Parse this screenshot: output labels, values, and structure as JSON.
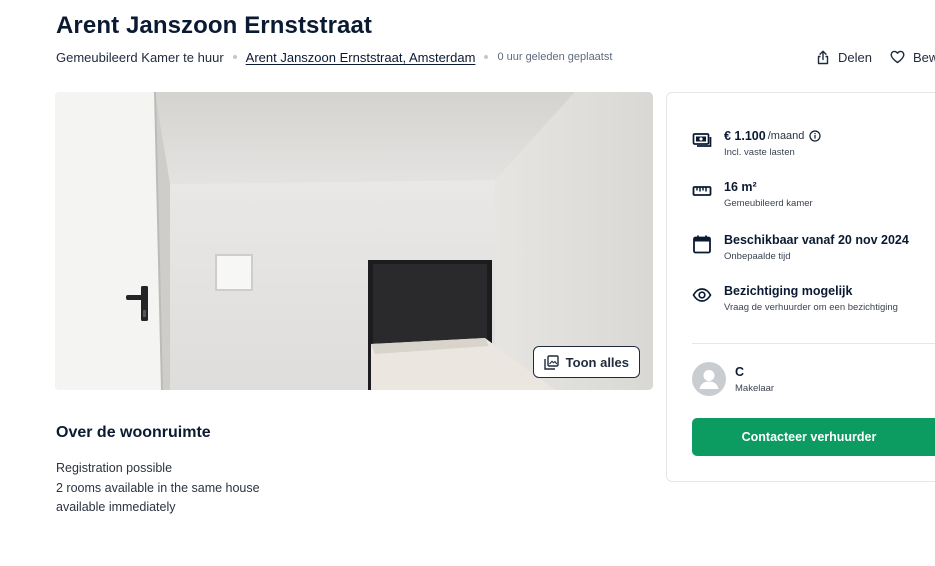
{
  "listing": {
    "title": "Arent Janszoon Ernststraat",
    "type": "Gemeubileerd Kamer te huur",
    "address_link": "Arent Janszoon Ernststraat, Amsterdam",
    "posted": "0 uur geleden geplaatst"
  },
  "actions": {
    "share": "Delen",
    "save": "Bew"
  },
  "gallery": {
    "show_all": "Toon alles"
  },
  "about": {
    "title": "Over de woonruimte",
    "lines": [
      "Registration possible",
      "2 rooms available in the same house",
      "available immediately"
    ]
  },
  "details": {
    "price": {
      "value": "€ 1.100",
      "unit": "/maand",
      "note": "Incl. vaste lasten",
      "icon": "money-icon"
    },
    "size": {
      "value": "16 m²",
      "note": "Gemeubileerd kamer",
      "icon": "ruler-icon"
    },
    "availability": {
      "value": "Beschikbaar vanaf 20 nov 2024",
      "note": "Onbepaalde tijd",
      "icon": "calendar-icon"
    },
    "viewing": {
      "value": "Bezichtiging mogelijk",
      "note": "Vraag de verhuurder om een bezichtiging",
      "icon": "eye-icon"
    }
  },
  "agent": {
    "name": "C",
    "role": "Makelaar"
  },
  "cta": {
    "contact": "Contacteer verhuurder",
    "color": "#0c9b61"
  }
}
